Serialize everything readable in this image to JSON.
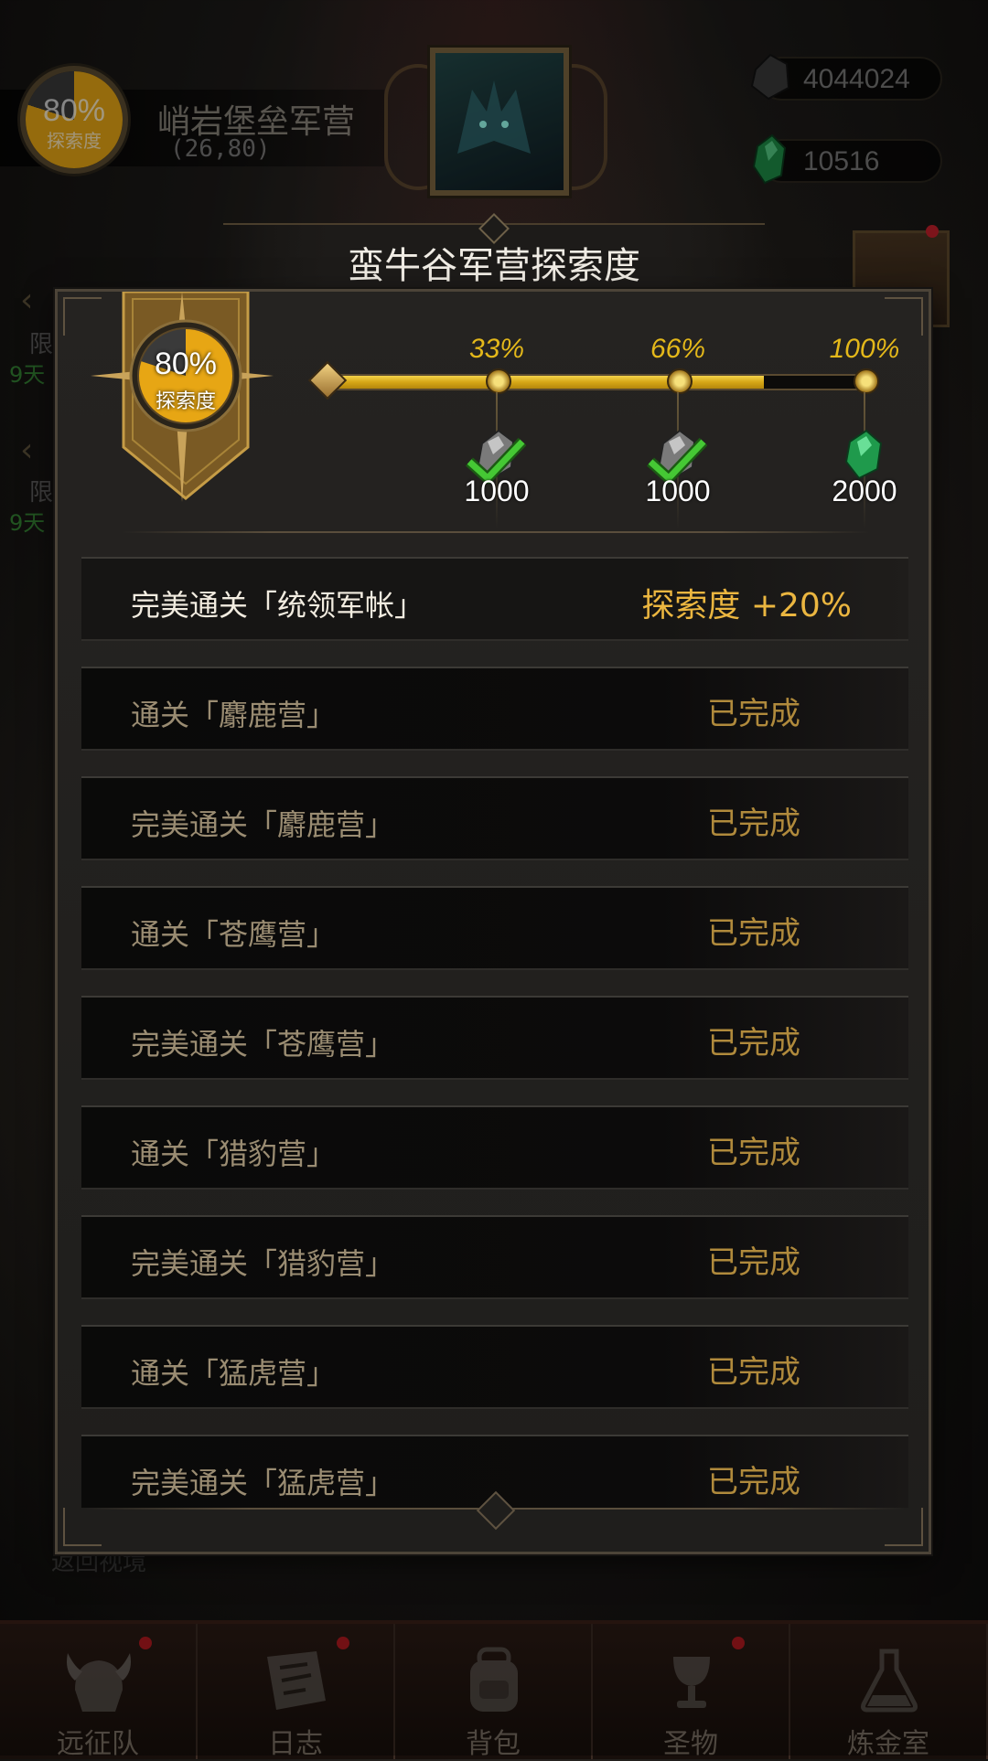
{
  "hud": {
    "location_badge": {
      "percent": "80%",
      "label": "探索度",
      "progress": 0.8
    },
    "location_name": "峭岩堡垒军营",
    "location_coords": "(26,80)",
    "resources": [
      {
        "icon": "silver-ore-icon",
        "value": "4044024"
      },
      {
        "icon": "emerald-gem-icon",
        "value": "10516"
      }
    ],
    "side_items": [
      {
        "label": "限",
        "timer": "9天"
      },
      {
        "label": "限",
        "timer": "9天"
      }
    ],
    "under_text": "返回视境"
  },
  "modal": {
    "title": "蛮牛谷军营探索度",
    "badge": {
      "percent": "80%",
      "label": "探索度",
      "progress": 0.8
    },
    "progress": 0.8,
    "milestones": [
      {
        "percent": "33%",
        "amount": "1000",
        "reward_icon": "silver-ore-icon",
        "claimed": true
      },
      {
        "percent": "66%",
        "amount": "1000",
        "reward_icon": "silver-ore-icon",
        "claimed": true
      },
      {
        "percent": "100%",
        "amount": "2000",
        "reward_icon": "emerald-gem-icon",
        "claimed": false
      }
    ],
    "tasks": [
      {
        "name": "完美通关「统领军帐」",
        "status": "探索度 +20%",
        "active": true
      },
      {
        "name": "通关「麝鹿营」",
        "status": "已完成",
        "active": false
      },
      {
        "name": "完美通关「麝鹿营」",
        "status": "已完成",
        "active": false
      },
      {
        "name": "通关「苍鹰营」",
        "status": "已完成",
        "active": false
      },
      {
        "name": "完美通关「苍鹰营」",
        "status": "已完成",
        "active": false
      },
      {
        "name": "通关「猎豹营」",
        "status": "已完成",
        "active": false
      },
      {
        "name": "完美通关「猎豹营」",
        "status": "已完成",
        "active": false
      },
      {
        "name": "通关「猛虎营」",
        "status": "已完成",
        "active": false
      },
      {
        "name": "完美通关「猛虎营」",
        "status": "已完成",
        "active": false
      }
    ]
  },
  "bottom_nav": [
    {
      "label": "远征队",
      "icon": "viking-helmet-icon",
      "badge": true
    },
    {
      "label": "日志",
      "icon": "scroll-map-icon",
      "badge": true
    },
    {
      "label": "背包",
      "icon": "backpack-icon",
      "badge": false
    },
    {
      "label": "圣物",
      "icon": "chalice-icon",
      "badge": true
    },
    {
      "label": "炼金室",
      "icon": "alchemy-flask-icon",
      "badge": false
    }
  ],
  "colors": {
    "gold": "#e4b81a",
    "completed": "#b08a3c",
    "check_green": "#3fc23a",
    "alert_red": "#b01a20"
  }
}
